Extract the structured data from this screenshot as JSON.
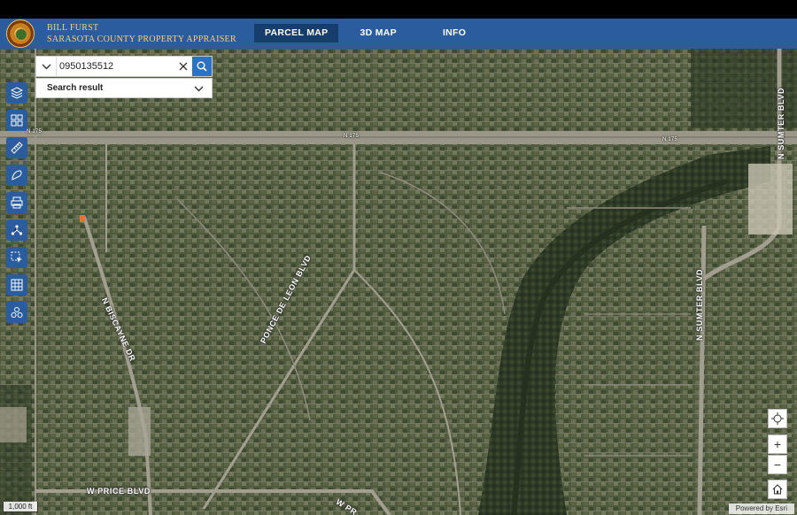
{
  "header": {
    "brand_line1": "BILL FURST",
    "brand_line2": "SARASOTA COUNTY PROPERTY APPRAISER",
    "tabs": [
      {
        "label": "PARCEL MAP",
        "active": true
      },
      {
        "label": "3D MAP",
        "active": false
      },
      {
        "label": "INFO",
        "active": false
      }
    ]
  },
  "search": {
    "value": "0950135512",
    "result_label": "Search result"
  },
  "toolbar": {
    "icons": [
      "layers-icon",
      "basemap-grid-icon",
      "measure-ruler-icon",
      "draw-icon",
      "print-icon",
      "share-icon",
      "select-icon",
      "table-icon",
      "analysis-icon"
    ]
  },
  "map": {
    "road_labels": {
      "n175_left": "N 175",
      "n175_mid": "N 175",
      "n175_right": "N 175",
      "n_sumter_top": "N SUMTER BLVD",
      "n_sumter_mid": "N SUMTER BLVD",
      "biscayne": "N BISCAYNE DR",
      "ponce": "PONCE DE LEON BLVD",
      "price": "W PRICE BLVD",
      "w_corner": "W PR"
    },
    "zoom_plus": "+",
    "zoom_minus": "−",
    "scale_label": "1,000 ft",
    "attribution": "Powered by Esri",
    "colors": {
      "header": "#2a5c9e",
      "tool": "#2a5c9e",
      "search_button": "#2872c8",
      "brand_text": "#f4d27a"
    }
  }
}
